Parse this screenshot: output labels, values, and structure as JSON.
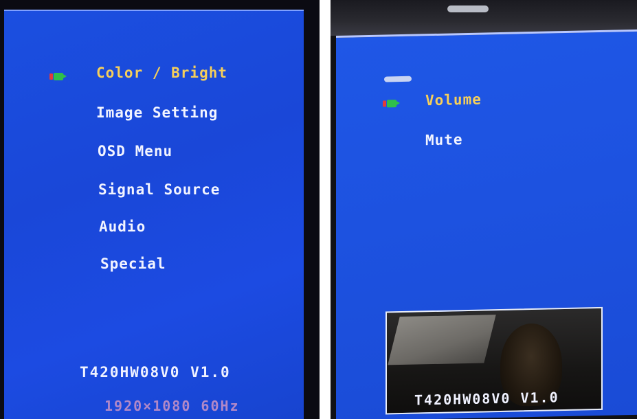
{
  "left_osd": {
    "menu_items": [
      {
        "label": "Color / Bright",
        "selected": true
      },
      {
        "label": "Image  Setting",
        "selected": false
      },
      {
        "label": "OSD  Menu",
        "selected": false
      },
      {
        "label": "Signal  Source",
        "selected": false
      },
      {
        "label": "Audio",
        "selected": false
      },
      {
        "label": "Special",
        "selected": false
      }
    ],
    "firmware_version": "T420HW08V0  V1.0",
    "resolution": "1920×1080  60Hz"
  },
  "right_osd": {
    "menu_items": [
      {
        "label": "Volume",
        "selected": true
      },
      {
        "label": "Mute",
        "selected": false
      }
    ],
    "firmware_version": "T420HW08V0  V1.0"
  },
  "colors": {
    "osd_background": "#1b4fe0",
    "selected_text": "#f6cf5a",
    "normal_text": "#f2f4ff",
    "marker_green": "#2fbf4a",
    "marker_red": "#e23b3b",
    "resolution_text": "#b088c8"
  },
  "icons": {
    "selection_marker": "battery-arrow-icon"
  }
}
